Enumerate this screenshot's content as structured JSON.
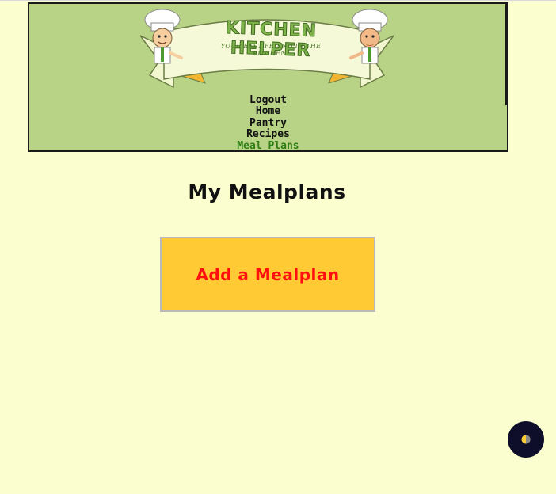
{
  "header": {
    "logo": {
      "title": "KITCHEN HELPER",
      "subtitle": "YOUR BEST FRIEND IN THE KITCHEN!",
      "icon": "chef-mascots-banner"
    },
    "nav": [
      {
        "label": "Logout",
        "active": false
      },
      {
        "label": "Home",
        "active": false
      },
      {
        "label": "Pantry",
        "active": false
      },
      {
        "label": "Recipes",
        "active": false
      },
      {
        "label": "Meal Plans",
        "active": true
      }
    ]
  },
  "main": {
    "title": "My Mealplans",
    "add_button_label": "Add a Mealplan"
  },
  "theme_toggle": {
    "icon": "half-moon-contrast-icon"
  },
  "colors": {
    "page_background": "#fbffd0",
    "header_background": "#b8d286",
    "active_nav": "#2e7d12",
    "button_background": "#ffca33",
    "button_text": "#ff0f0f",
    "toggle_background": "#0e0e2b"
  }
}
